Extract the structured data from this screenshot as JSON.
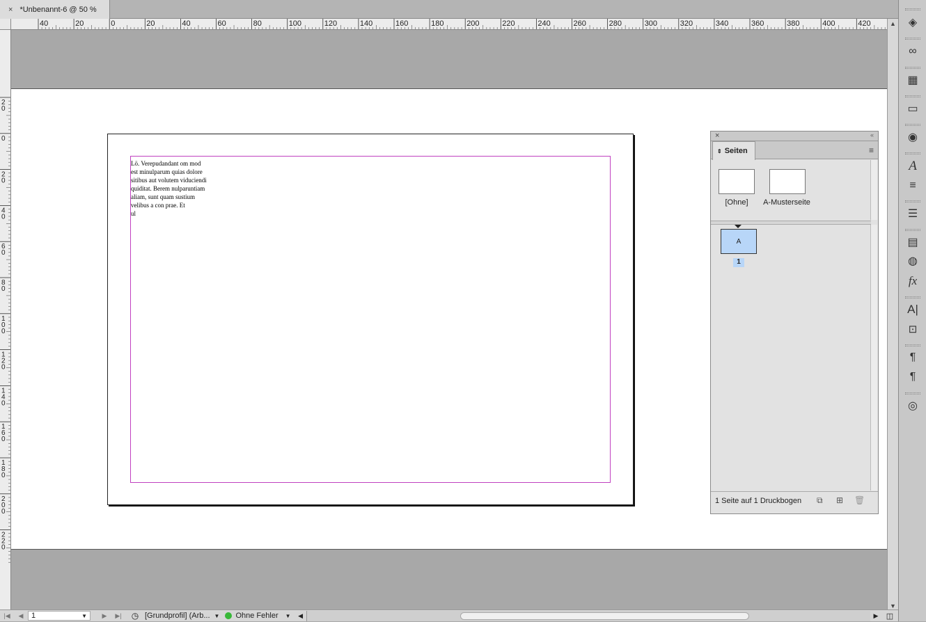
{
  "document_tab": {
    "close": "×",
    "title": "*Unbenannt-6 @ 50 %"
  },
  "ruler_h": {
    "labels": [
      "40",
      "20",
      "0",
      "20",
      "40",
      "60",
      "80",
      "100",
      "120",
      "140",
      "160",
      "180",
      "200",
      "220",
      "240",
      "260",
      "280",
      "300",
      "320",
      "340",
      "360",
      "380",
      "400",
      "420"
    ]
  },
  "ruler_v": {
    "labels": [
      "2 0",
      "0",
      "2 0",
      "4 0",
      "6 0",
      "8 0",
      "1 0 0",
      "1 2 0",
      "1 4 0",
      "1 6 0",
      "1 8 0",
      "2 0 0",
      "2 2 0"
    ]
  },
  "text_frame": {
    "lines": [
      "Lö. Verepudandant om mod",
      "est minulparum quias dolore",
      "sitibus aut volutem viduciendi",
      "quiditat. Berem nulparuntiam",
      "aliam, sunt quam sustium",
      "velibus a con prae. Et",
      "ul"
    ]
  },
  "statusbar": {
    "page_value": "1",
    "profile": "[Grundprofil] (Arb...",
    "preflight": "Ohne Fehler"
  },
  "pages_panel": {
    "tab_label": "Seiten",
    "masters": [
      {
        "label": "[Ohne]"
      },
      {
        "label": "A-Musterseite"
      }
    ],
    "page_prefix": "A",
    "page_number": "1",
    "footer_text": "1 Seite auf 1 Druckbogen"
  },
  "toolstrip": {
    "icons": [
      "layers-icon",
      "links-icon",
      "swatches-icon",
      "gradient-icon",
      "color-icon",
      "character-styles-icon",
      "stroke-icon",
      "paragraph-rules-icon",
      "text-wrap-icon",
      "color-picker-icon",
      "effects-icon",
      "character-icon",
      "object-styles-icon",
      "paragraph-icon",
      "paragraph-styles-icon",
      "cc-libraries-icon"
    ]
  }
}
